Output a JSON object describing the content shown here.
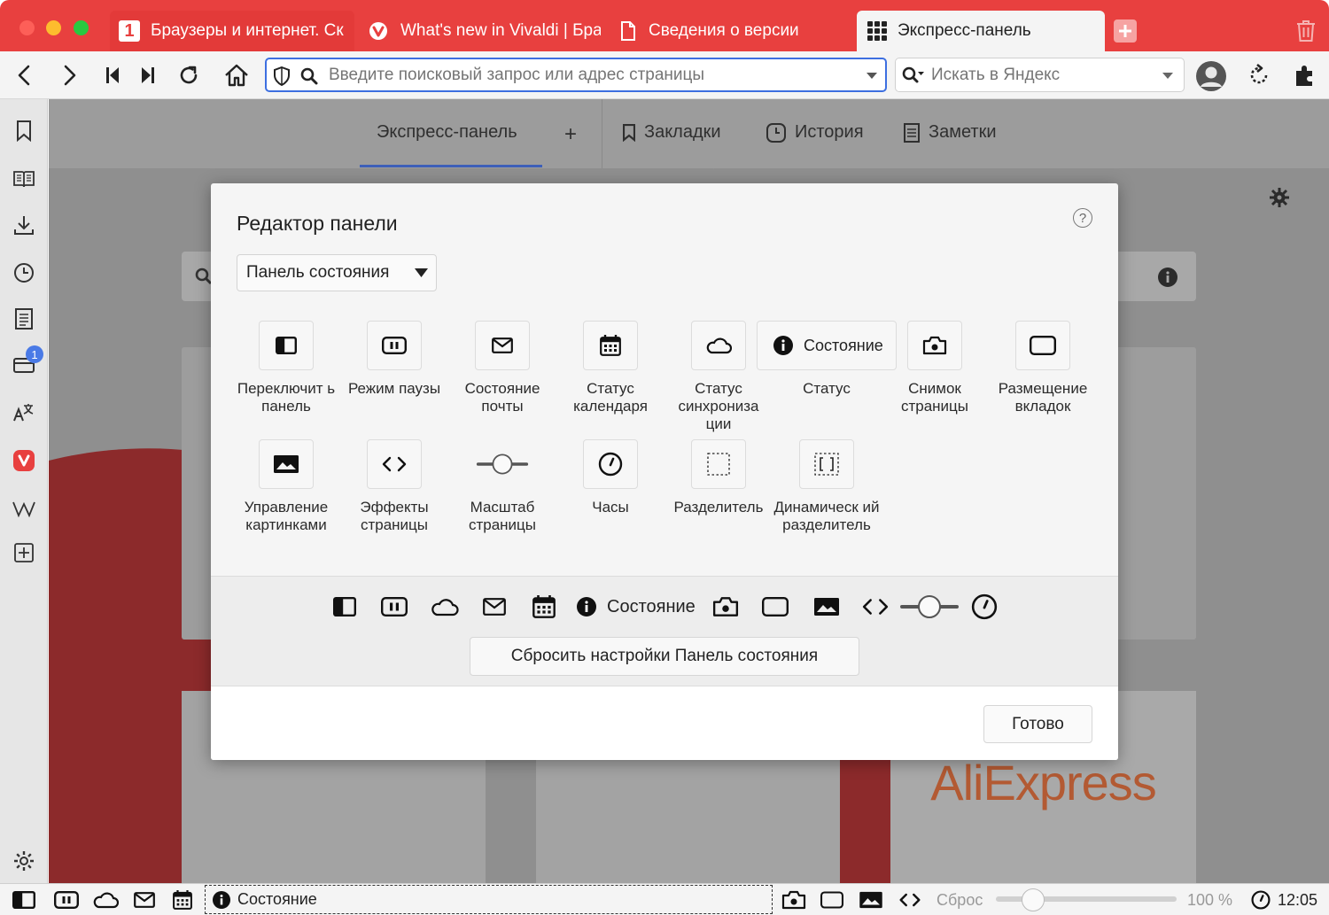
{
  "tabs": [
    {
      "label": "Браузеры и интернет. Ск",
      "icon": "yandex-logo-icon"
    },
    {
      "label": "What's new in Vivaldi | Бра",
      "icon": "vivaldi-logo-icon"
    },
    {
      "label": "Сведения о версии",
      "icon": "document-icon"
    },
    {
      "label": "Экспресс-панель",
      "icon": "grid-icon"
    }
  ],
  "address_bar": {
    "placeholder": "Введите поисковый запрос или адрес страницы",
    "search_placeholder": "Искать в Яндекс"
  },
  "speed_dial_nav": {
    "tab_express": "Экспресс-панель",
    "add": "+",
    "bookmarks": "Закладки",
    "history": "История",
    "notes": "Заметки"
  },
  "sidebar": {
    "wallet_badge": "1"
  },
  "modal": {
    "title": "Редактор панели",
    "help": "?",
    "dropdown_value": "Панель состояния",
    "items": [
      {
        "label": "Переключит ь панель",
        "icon": "panel-toggle-icon"
      },
      {
        "label": "Режим паузы",
        "icon": "pause-icon"
      },
      {
        "label": "Состояние почты",
        "icon": "mail-icon"
      },
      {
        "label": "Статус календаря",
        "icon": "calendar-icon"
      },
      {
        "label": "Статус синхрониза ции",
        "icon": "cloud-icon"
      },
      {
        "label": "Статус",
        "button_text": "Состояние",
        "icon": "info-icon"
      },
      {
        "label": "Снимок страницы",
        "icon": "camera-icon"
      },
      {
        "label": "Размещение вкладок",
        "icon": "tile-icon"
      },
      {
        "label": "Управление картинками",
        "icon": "image-icon"
      },
      {
        "label": "Эффекты страницы",
        "icon": "code-icon"
      },
      {
        "label": "Масштаб страницы",
        "icon": "slider-icon"
      },
      {
        "label": "Часы",
        "icon": "clock-icon"
      },
      {
        "label": "Разделитель",
        "icon": "separator-icon"
      },
      {
        "label": "Динамическ ий разделитель",
        "icon": "flex-separator-icon"
      }
    ],
    "preview_status": "Состояние",
    "reset_button": "Сбросить настройки Панель состояния",
    "done_button": "Готово"
  },
  "background": {
    "aliexpress": "AliExpress"
  },
  "statusbar": {
    "status_text": "Состояние",
    "reset": "Сброс",
    "zoom": "100 %",
    "time": "12:05"
  },
  "colors": {
    "vivaldi_red": "#e8403f",
    "accent_blue": "#3d6fe0",
    "badge_blue": "#4a7ae6"
  }
}
